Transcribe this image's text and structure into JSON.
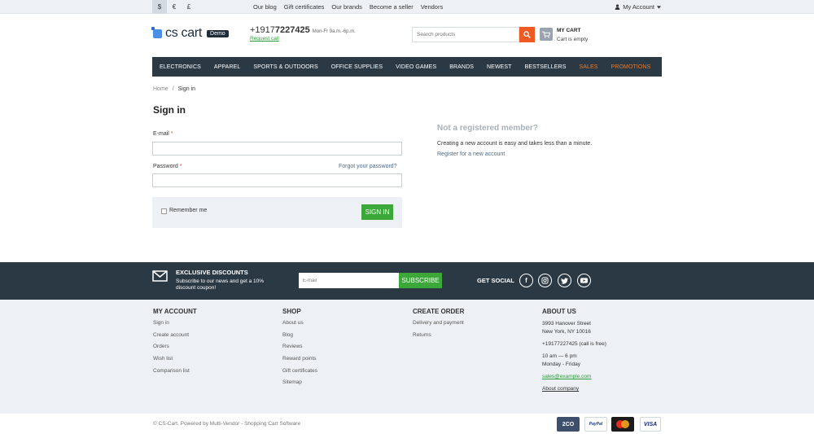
{
  "topbar": {
    "currencies": [
      "$",
      "€",
      "£"
    ],
    "links": [
      "Our blog",
      "Gift certificates",
      "Our brands",
      "Become a seller",
      "Vendors"
    ],
    "account_label": "My Account"
  },
  "header": {
    "logo_text": "cs cart",
    "logo_badge": "Demo",
    "phone_prefix": "+1917",
    "phone_bold": "7227425",
    "phone_hours": "Mon-Fr 9a.m.-6p.m.",
    "request_call": "Request call",
    "search_placeholder": "Search products",
    "cart_title": "MY CART",
    "cart_status": "Cart is empty"
  },
  "nav": {
    "items": [
      "ELECTRONICS",
      "APPAREL",
      "SPORTS & OUTDOORS",
      "OFFICE SUPPLIES",
      "VIDEO GAMES",
      "BRANDS",
      "NEWEST",
      "BESTSELLERS",
      "SALES",
      "PROMOTIONS"
    ],
    "accent_color": "#ef7a23"
  },
  "breadcrumb": {
    "home": "Home",
    "sep": "/",
    "current": "Sign in"
  },
  "signin": {
    "title": "Sign in",
    "email_label": "E-mail",
    "password_label": "Password",
    "required_mark": "*",
    "forgot": "Forgot your password?",
    "remember": "Remember me",
    "button": "SIGN IN"
  },
  "register": {
    "title": "Not a registered member?",
    "text": "Creating a new account is easy and takes less than a minute.",
    "link": "Register for a new account"
  },
  "subscribe": {
    "title": "EXCLUSIVE DISCOUNTS",
    "text": "Subscribe to our news and get a 10% discount coupon!",
    "placeholder": "E-mail",
    "button": "SUBSCRIBE",
    "social_label": "GET SOCIAL",
    "social_icons": [
      "facebook-icon",
      "instagram-icon",
      "twitter-icon",
      "youtube-icon"
    ]
  },
  "footer": {
    "my_account": {
      "title": "MY ACCOUNT",
      "links": [
        "Sign in",
        "Create account",
        "Orders",
        "Wish list",
        "Comparison list"
      ]
    },
    "shop": {
      "title": "SHOP",
      "links": [
        "About us",
        "Blog",
        "Reviews",
        "Reward points",
        "Gift certificates",
        "Sitemap"
      ]
    },
    "create_order": {
      "title": "CREATE ORDER",
      "links": [
        "Delivery and payment",
        "Returns"
      ]
    },
    "about": {
      "title": "ABOUT US",
      "address1": "3993 Hanover Street",
      "address2": "New York, NY 10016",
      "phone": "+19177227425 (call is free)",
      "hours1": "10 am — 6 pm",
      "hours2": "Monday - Friday",
      "email": "sales@example.com",
      "company": "About company"
    },
    "copyright": "© CS-Cart.  Powered by Multi-Vendor - Shopping Cart Software",
    "payments": [
      "2CO",
      "PayPal",
      "mastercard",
      "VISA"
    ]
  },
  "colors": {
    "dark": "#2b3945",
    "green": "#3ca83a",
    "orange": "#ef5a23",
    "light_bg": "#edf1f5"
  }
}
